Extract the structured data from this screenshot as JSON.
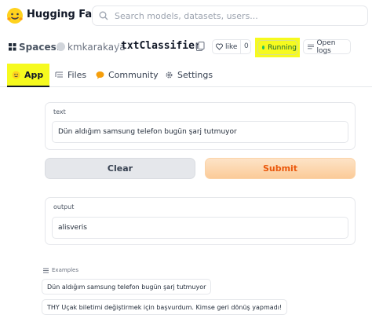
{
  "header": {
    "brand": "Hugging Face",
    "search_placeholder": "Search models, datasets, users..."
  },
  "space": {
    "section_label": "Spaces:",
    "owner": "kmkarakaya",
    "separator": "/",
    "name": "txtClassifier",
    "like_label": "like",
    "like_count": "0",
    "status": "Running",
    "logs_label": "Open logs"
  },
  "tabs": [
    {
      "label": "App",
      "icon": "app-icon",
      "active": true
    },
    {
      "label": "Files",
      "icon": "files-icon"
    },
    {
      "label": "Community",
      "icon": "community-icon"
    },
    {
      "label": "Settings",
      "icon": "gear-icon"
    }
  ],
  "form": {
    "input_label": "text",
    "input_value": "Dün aldığım samsung telefon bugün şarj tutmuyor",
    "clear_label": "Clear",
    "submit_label": "Submit",
    "output_label": "output",
    "output_value": "alisveris"
  },
  "examples": {
    "label": "Examples",
    "items": [
      "Dün aldığım samsung telefon bugün şarj tutmuyor",
      "THY Uçak biletimi değiştirmek için başvurdum. Kimse geri dönüş yapmadı!"
    ]
  },
  "colors": {
    "highlight": "#f6fa1f",
    "submit_text": "#ea580c",
    "running_dot": "#22c55e"
  }
}
